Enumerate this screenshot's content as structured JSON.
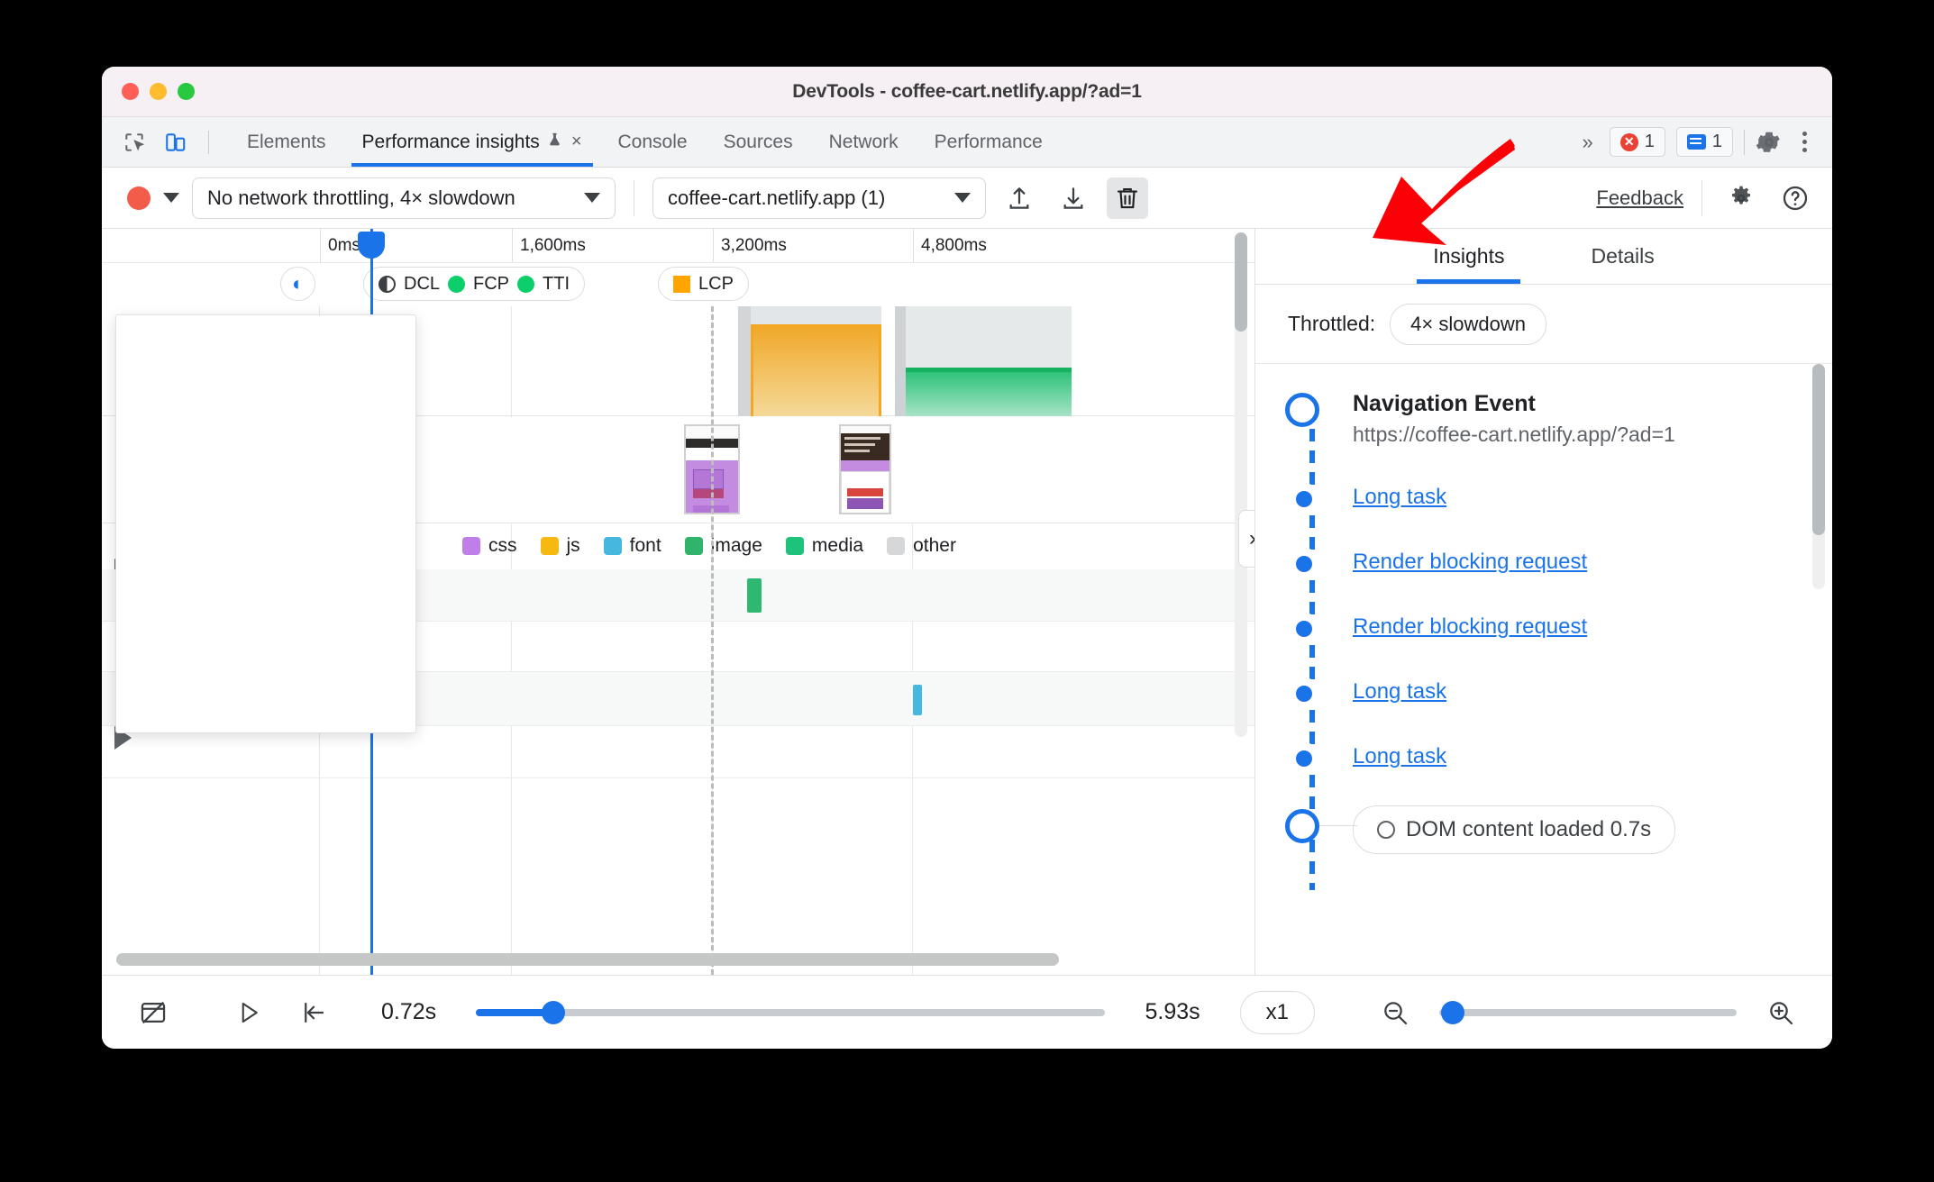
{
  "window": {
    "title": "DevTools - coffee-cart.netlify.app/?ad=1"
  },
  "tabbar": {
    "inspect_icon": "inspect-element-icon",
    "device_icon": "device-toolbar-icon",
    "tabs": [
      {
        "label": "Elements",
        "active": false
      },
      {
        "label": "Performance insights",
        "active": true,
        "experimental": true,
        "closable": true
      },
      {
        "label": "Console",
        "active": false
      },
      {
        "label": "Sources",
        "active": false
      },
      {
        "label": "Network",
        "active": false
      },
      {
        "label": "Performance",
        "active": false
      }
    ],
    "overflow_label": "»",
    "error_count": "1",
    "message_count": "1",
    "close_label": "×",
    "flask_label": "⚗"
  },
  "toolbar": {
    "record_label": "record-button",
    "throttling_value": "No network throttling, 4× slowdown",
    "page_value": "coffee-cart.netlify.app (1)",
    "upload_label": "upload-icon",
    "download_label": "download-icon",
    "trash_label": "trash-icon",
    "feedback_label": "Feedback",
    "settings_label": "settings-icon",
    "help_label": "help-icon"
  },
  "timeline": {
    "ticks": [
      "0ms",
      "1,600ms",
      "3,200ms",
      "4,800ms"
    ],
    "markers": [
      {
        "label": "DCL",
        "type": "half-circle",
        "color": "#3c4043"
      },
      {
        "label": "FCP",
        "type": "circle",
        "color": "#0cce6b"
      },
      {
        "label": "TTI",
        "type": "circle",
        "color": "#0cce6b"
      },
      {
        "label": "LCP",
        "type": "square",
        "color": "#ffa400"
      }
    ],
    "legend": [
      {
        "label": "css",
        "color": "#c07ee8"
      },
      {
        "label": "js",
        "color": "#f5b912"
      },
      {
        "label": "font",
        "color": "#46b8e0"
      },
      {
        "label": "image",
        "color": "#30b36b"
      },
      {
        "label": "media",
        "color": "#1ec27a"
      },
      {
        "label": "other",
        "color": "#d5d7d8"
      }
    ],
    "expand_handle": "›",
    "track_arrow": "collapsed-track-arrow"
  },
  "sidebar": {
    "tabs": [
      {
        "label": "Insights",
        "active": true
      },
      {
        "label": "Details",
        "active": false
      }
    ],
    "throttled_label": "Throttled:",
    "throttled_value": "4× slowdown",
    "navigation": {
      "title": "Navigation Event",
      "url": "https://coffee-cart.netlify.app/?ad=1"
    },
    "items": [
      {
        "label": "Long task"
      },
      {
        "label": "Render blocking request"
      },
      {
        "label": "Render blocking request"
      },
      {
        "label": "Long task"
      },
      {
        "label": "Long task"
      }
    ],
    "dom_event": "DOM content loaded 0.7s"
  },
  "bottombar": {
    "screenshot_toggle": "hide-screenshots-icon",
    "play_label": "play-icon",
    "jump_start_label": "jump-to-start-icon",
    "start_time": "0.72s",
    "end_time": "5.93s",
    "speed": "x1",
    "zoom_out_label": "zoom-out-icon",
    "zoom_in_label": "zoom-in-icon"
  },
  "colors": {
    "accent": "#1a73e8",
    "record": "#f45c4a",
    "error": "#ea4335",
    "arrow": "#fb0007"
  }
}
